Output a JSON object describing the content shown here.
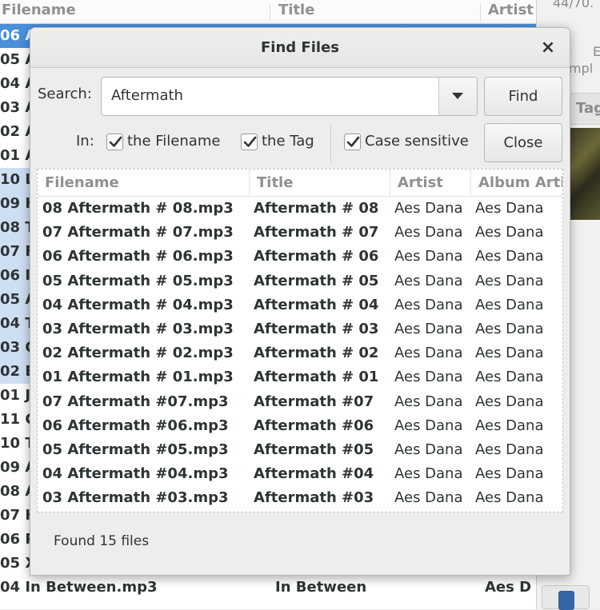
{
  "background": {
    "columns": [
      "Filename",
      "Title",
      "Artist"
    ],
    "rows": [
      {
        "filename": "06 A",
        "title": "",
        "artist": "",
        "state": "selected"
      },
      {
        "filename": "05 A",
        "title": "",
        "artist": "",
        "state": "normal"
      },
      {
        "filename": "04 A",
        "title": "",
        "artist": "",
        "state": "normal"
      },
      {
        "filename": "03 A",
        "title": "",
        "artist": "",
        "state": "normal"
      },
      {
        "filename": "02 A",
        "title": "",
        "artist": "",
        "state": "normal"
      },
      {
        "filename": "01 A",
        "title": "",
        "artist": "",
        "state": "normal"
      },
      {
        "filename": "10 L",
        "title": "",
        "artist": "",
        "state": "hl"
      },
      {
        "filename": "09 H",
        "title": "",
        "artist": "",
        "state": "hl"
      },
      {
        "filename": "08 T",
        "title": "",
        "artist": "",
        "state": "hl"
      },
      {
        "filename": "07 F",
        "title": "",
        "artist": "",
        "state": "hl"
      },
      {
        "filename": "06 I",
        "title": "",
        "artist": "",
        "state": "hl"
      },
      {
        "filename": "05 A",
        "title": "",
        "artist": "",
        "state": "hl"
      },
      {
        "filename": "04 T",
        "title": "",
        "artist": "",
        "state": "hl"
      },
      {
        "filename": "03 C",
        "title": "",
        "artist": "",
        "state": "hl"
      },
      {
        "filename": "02 E",
        "title": "",
        "artist": "",
        "state": "hl"
      },
      {
        "filename": "01 J",
        "title": "",
        "artist": "",
        "state": "normal"
      },
      {
        "filename": "11 C",
        "title": "",
        "artist": "",
        "state": "normal"
      },
      {
        "filename": "10 T",
        "title": "",
        "artist": "",
        "state": "normal"
      },
      {
        "filename": "09 A",
        "title": "",
        "artist": "",
        "state": "normal"
      },
      {
        "filename": "08 A",
        "title": "",
        "artist": "",
        "state": "normal"
      },
      {
        "filename": "07 H",
        "title": "",
        "artist": "",
        "state": "normal"
      },
      {
        "filename": "06 P",
        "title": "",
        "artist": "",
        "state": "normal"
      },
      {
        "filename": "05 X",
        "title": "",
        "artist": "",
        "state": "normal"
      },
      {
        "filename": "04 In Between.mp3",
        "title": "In Between",
        "artist": "Aes D",
        "state": "normal"
      }
    ],
    "right_panel": {
      "count_text": "44/70.",
      "cut_a": "E",
      "cut_b": "mpl",
      "tag_tab": "Tag"
    }
  },
  "dialog": {
    "title": "Find Files",
    "close_glyph": "×",
    "search_label": "Search:",
    "search_value": "Aftermath",
    "find_label": "Find",
    "close_label": "Close",
    "in_label": "In:",
    "options": {
      "filename_label": "the Filename",
      "tag_label": "the Tag",
      "case_label": "Case sensitive"
    },
    "columns": [
      "Filename",
      "Title",
      "Artist",
      "Album Artist"
    ],
    "results": [
      {
        "filename": "08 Aftermath # 08.mp3",
        "title": "Aftermath # 08",
        "artist": "Aes Dana",
        "album_artist": "Aes Dana"
      },
      {
        "filename": "07 Aftermath # 07.mp3",
        "title": "Aftermath # 07",
        "artist": "Aes Dana",
        "album_artist": "Aes Dana"
      },
      {
        "filename": "06 Aftermath # 06.mp3",
        "title": "Aftermath # 06",
        "artist": "Aes Dana",
        "album_artist": "Aes Dana"
      },
      {
        "filename": "05 Aftermath # 05.mp3",
        "title": "Aftermath # 05",
        "artist": "Aes Dana",
        "album_artist": "Aes Dana"
      },
      {
        "filename": "04 Aftermath # 04.mp3",
        "title": "Aftermath # 04",
        "artist": "Aes Dana",
        "album_artist": "Aes Dana"
      },
      {
        "filename": "03 Aftermath # 03.mp3",
        "title": "Aftermath # 03",
        "artist": "Aes Dana",
        "album_artist": "Aes Dana"
      },
      {
        "filename": "02 Aftermath # 02.mp3",
        "title": "Aftermath # 02",
        "artist": "Aes Dana",
        "album_artist": "Aes Dana"
      },
      {
        "filename": "01 Aftermath # 01.mp3",
        "title": "Aftermath # 01",
        "artist": "Aes Dana",
        "album_artist": "Aes Dana"
      },
      {
        "filename": "07 Aftermath #07.mp3",
        "title": "Aftermath #07",
        "artist": "Aes Dana",
        "album_artist": "Aes Dana"
      },
      {
        "filename": "06 Aftermath #06.mp3",
        "title": "Aftermath #06",
        "artist": "Aes Dana",
        "album_artist": "Aes Dana"
      },
      {
        "filename": "05 Aftermath #05.mp3",
        "title": "Aftermath #05",
        "artist": "Aes Dana",
        "album_artist": "Aes Dana"
      },
      {
        "filename": "04 Aftermath #04.mp3",
        "title": "Aftermath #04",
        "artist": "Aes Dana",
        "album_artist": "Aes Dana"
      },
      {
        "filename": "03 Aftermath #03.mp3",
        "title": "Aftermath #03",
        "artist": "Aes Dana",
        "album_artist": "Aes Dana"
      }
    ],
    "status": "Found 15 files"
  },
  "colors": {
    "selection": "#4a90d9",
    "highlight": "#cfdff2",
    "dialog_bg": "#ededeb"
  },
  "icons": {
    "dropdown": "chevron-down-icon",
    "checkbox": "checkmark-icon",
    "close": "close-icon"
  }
}
